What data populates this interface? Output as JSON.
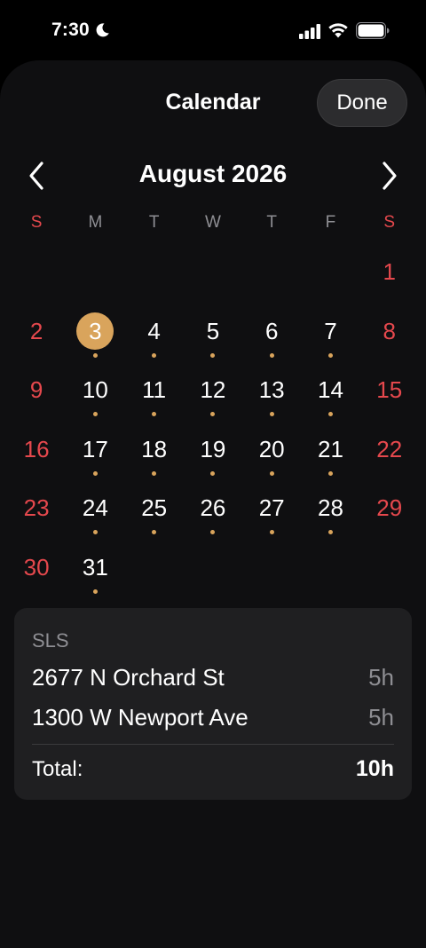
{
  "status_bar": {
    "time": "7:30",
    "focus_icon": "moon-icon",
    "signal_icon": "cellular-signal-icon",
    "wifi_icon": "wifi-icon",
    "battery_icon": "battery-icon"
  },
  "header": {
    "title": "Calendar",
    "done_label": "Done"
  },
  "calendar": {
    "month_label": "August 2026",
    "prev_icon": "chevron-left-icon",
    "next_icon": "chevron-right-icon",
    "weekdays": [
      "S",
      "M",
      "T",
      "W",
      "T",
      "F",
      "S"
    ],
    "first_weekday_index": 6,
    "days_in_month": 31,
    "selected_day": 3,
    "days_with_entries": [
      3,
      4,
      5,
      6,
      7,
      10,
      11,
      12,
      13,
      14,
      17,
      18,
      19,
      20,
      21,
      24,
      25,
      26,
      27,
      28,
      31
    ],
    "accent_color": "#d9a45c",
    "weekend_color": "#e5484d"
  },
  "summary": {
    "heading": "SLS",
    "entries": [
      {
        "address": "2677 N Orchard St",
        "hours": "5h"
      },
      {
        "address": "1300 W Newport Ave",
        "hours": "5h"
      }
    ],
    "total_label": "Total:",
    "total_value": "10h"
  }
}
